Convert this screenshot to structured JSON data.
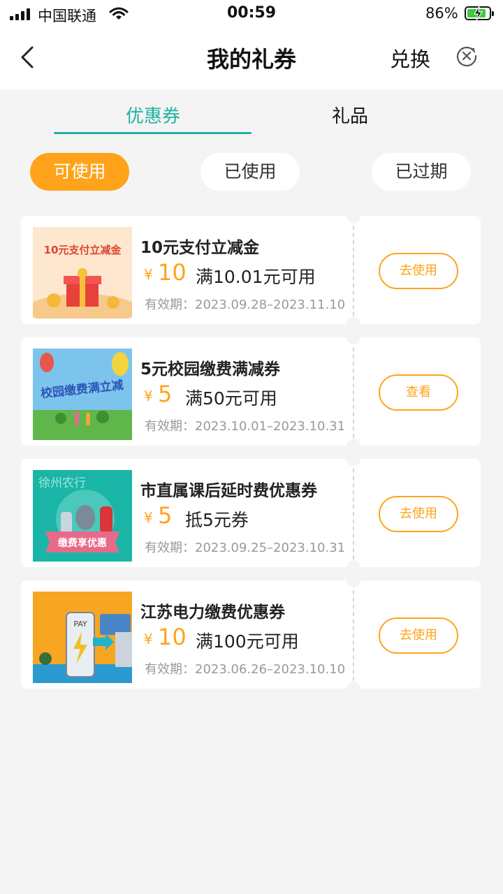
{
  "status_bar": {
    "carrier": "中国联通",
    "time": "00:59",
    "battery_percent": "86%",
    "battery_level": 0.86
  },
  "nav": {
    "title": "我的礼券",
    "exchange_label": "兑换",
    "back_icon": "chevron-left-icon",
    "close_icon": "close-circle-icon"
  },
  "tabs": [
    {
      "label": "优惠券",
      "active": true
    },
    {
      "label": "礼品",
      "active": false
    }
  ],
  "filters": [
    {
      "label": "可使用",
      "active": true
    },
    {
      "label": "已使用",
      "active": false
    },
    {
      "label": "已过期",
      "active": false
    }
  ],
  "coupons": [
    {
      "title": "10元支付立减金",
      "currency": "¥",
      "amount": "10",
      "condition": "满10.01元可用",
      "validity": "有效期：2023.09.28–2023.11.10",
      "action": "去使用",
      "image_text": "10元支付立减金"
    },
    {
      "title": "5元校园缴费满减券",
      "currency": "¥",
      "amount": "5",
      "condition": "满50元可用",
      "validity": "有效期：2023.10.01–2023.10.31",
      "action": "查看",
      "image_text": "校园缴费满立减"
    },
    {
      "title": "市直属课后延时费优惠券",
      "currency": "¥",
      "amount": "5",
      "condition": "抵5元券",
      "validity": "有效期：2023.09.25–2023.10.31",
      "action": "去使用",
      "image_text": "徐州农行",
      "image_banner": "缴费享优惠"
    },
    {
      "title": "江苏电力缴费优惠券",
      "currency": "¥",
      "amount": "10",
      "condition": "满100元可用",
      "validity": "有效期：2023.06.26–2023.10.10",
      "action": "去使用",
      "image_text": "PAY"
    }
  ],
  "colors": {
    "accent_teal": "#1fb3a5",
    "accent_orange": "#ffa31a",
    "background": "#f4f4f4"
  }
}
